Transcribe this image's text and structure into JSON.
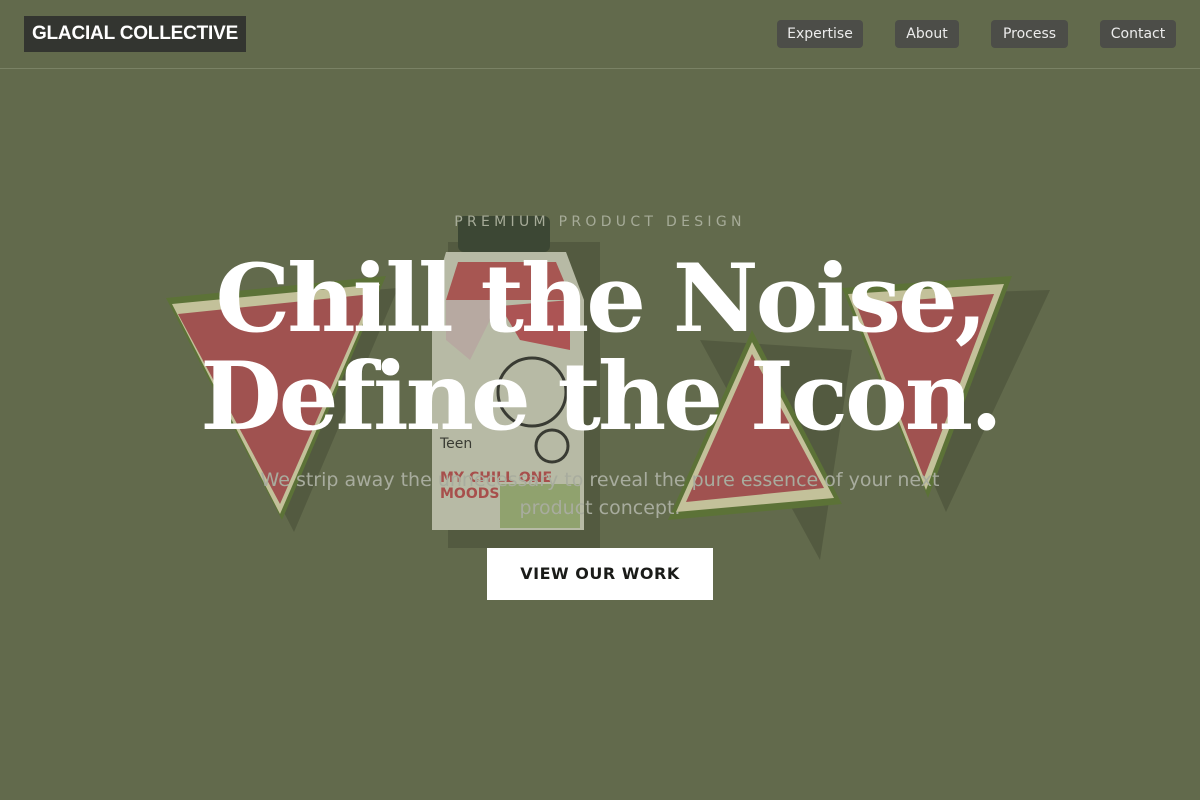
{
  "brand": {
    "name": "GLACIAL COLLECTIVE"
  },
  "nav": {
    "items": [
      {
        "label": "Expertise"
      },
      {
        "label": "About"
      },
      {
        "label": "Process"
      },
      {
        "label": "Contact"
      }
    ]
  },
  "hero": {
    "eyebrow": "PREMIUM PRODUCT DESIGN",
    "headline_line1": "Chill the Noise,",
    "headline_line2": "Define the Icon.",
    "subtitle": "We strip away the unnecessary to reveal the pure essence of your next product concept.",
    "cta_label": "VIEW OUR WORK"
  },
  "illustration": {
    "carton_text_teen": "Teen",
    "carton_text_line1": "MY CHILL ONE",
    "carton_text_line2": "MOODS"
  },
  "colors": {
    "background": "#626a4c",
    "logo_bg": "#333530",
    "nav_bg": "#4c4d48",
    "cta_bg": "#ffffff",
    "watermelon_flesh": "#b84a52",
    "watermelon_rind": "#4a6a22"
  }
}
